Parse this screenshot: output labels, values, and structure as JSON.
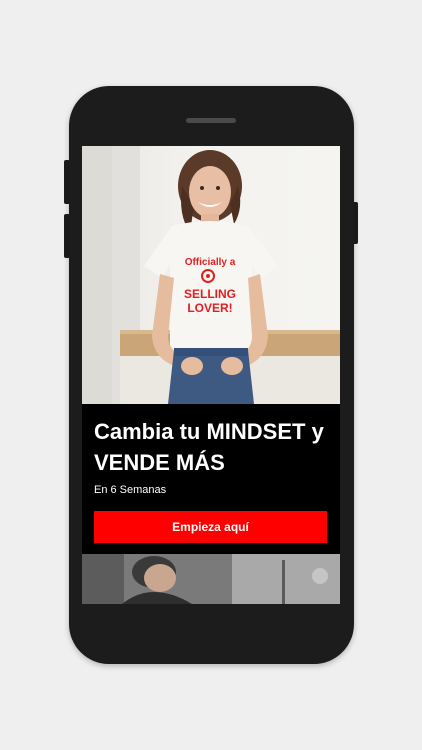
{
  "hero": {
    "headline": "Cambia tu MINDSET y VENDE MÁS",
    "subline": "En 6 Semanas",
    "cta_label": "Empieza aquí",
    "shirt_text_line1": "Officially a",
    "shirt_text_line2": "SELLING",
    "shirt_text_line3": "LOVER!"
  },
  "colors": {
    "accent": "#ff0000",
    "phone_frame": "#1c1c1c",
    "screen_bg": "#000000"
  },
  "icons": [
    "phone-speaker-icon"
  ]
}
